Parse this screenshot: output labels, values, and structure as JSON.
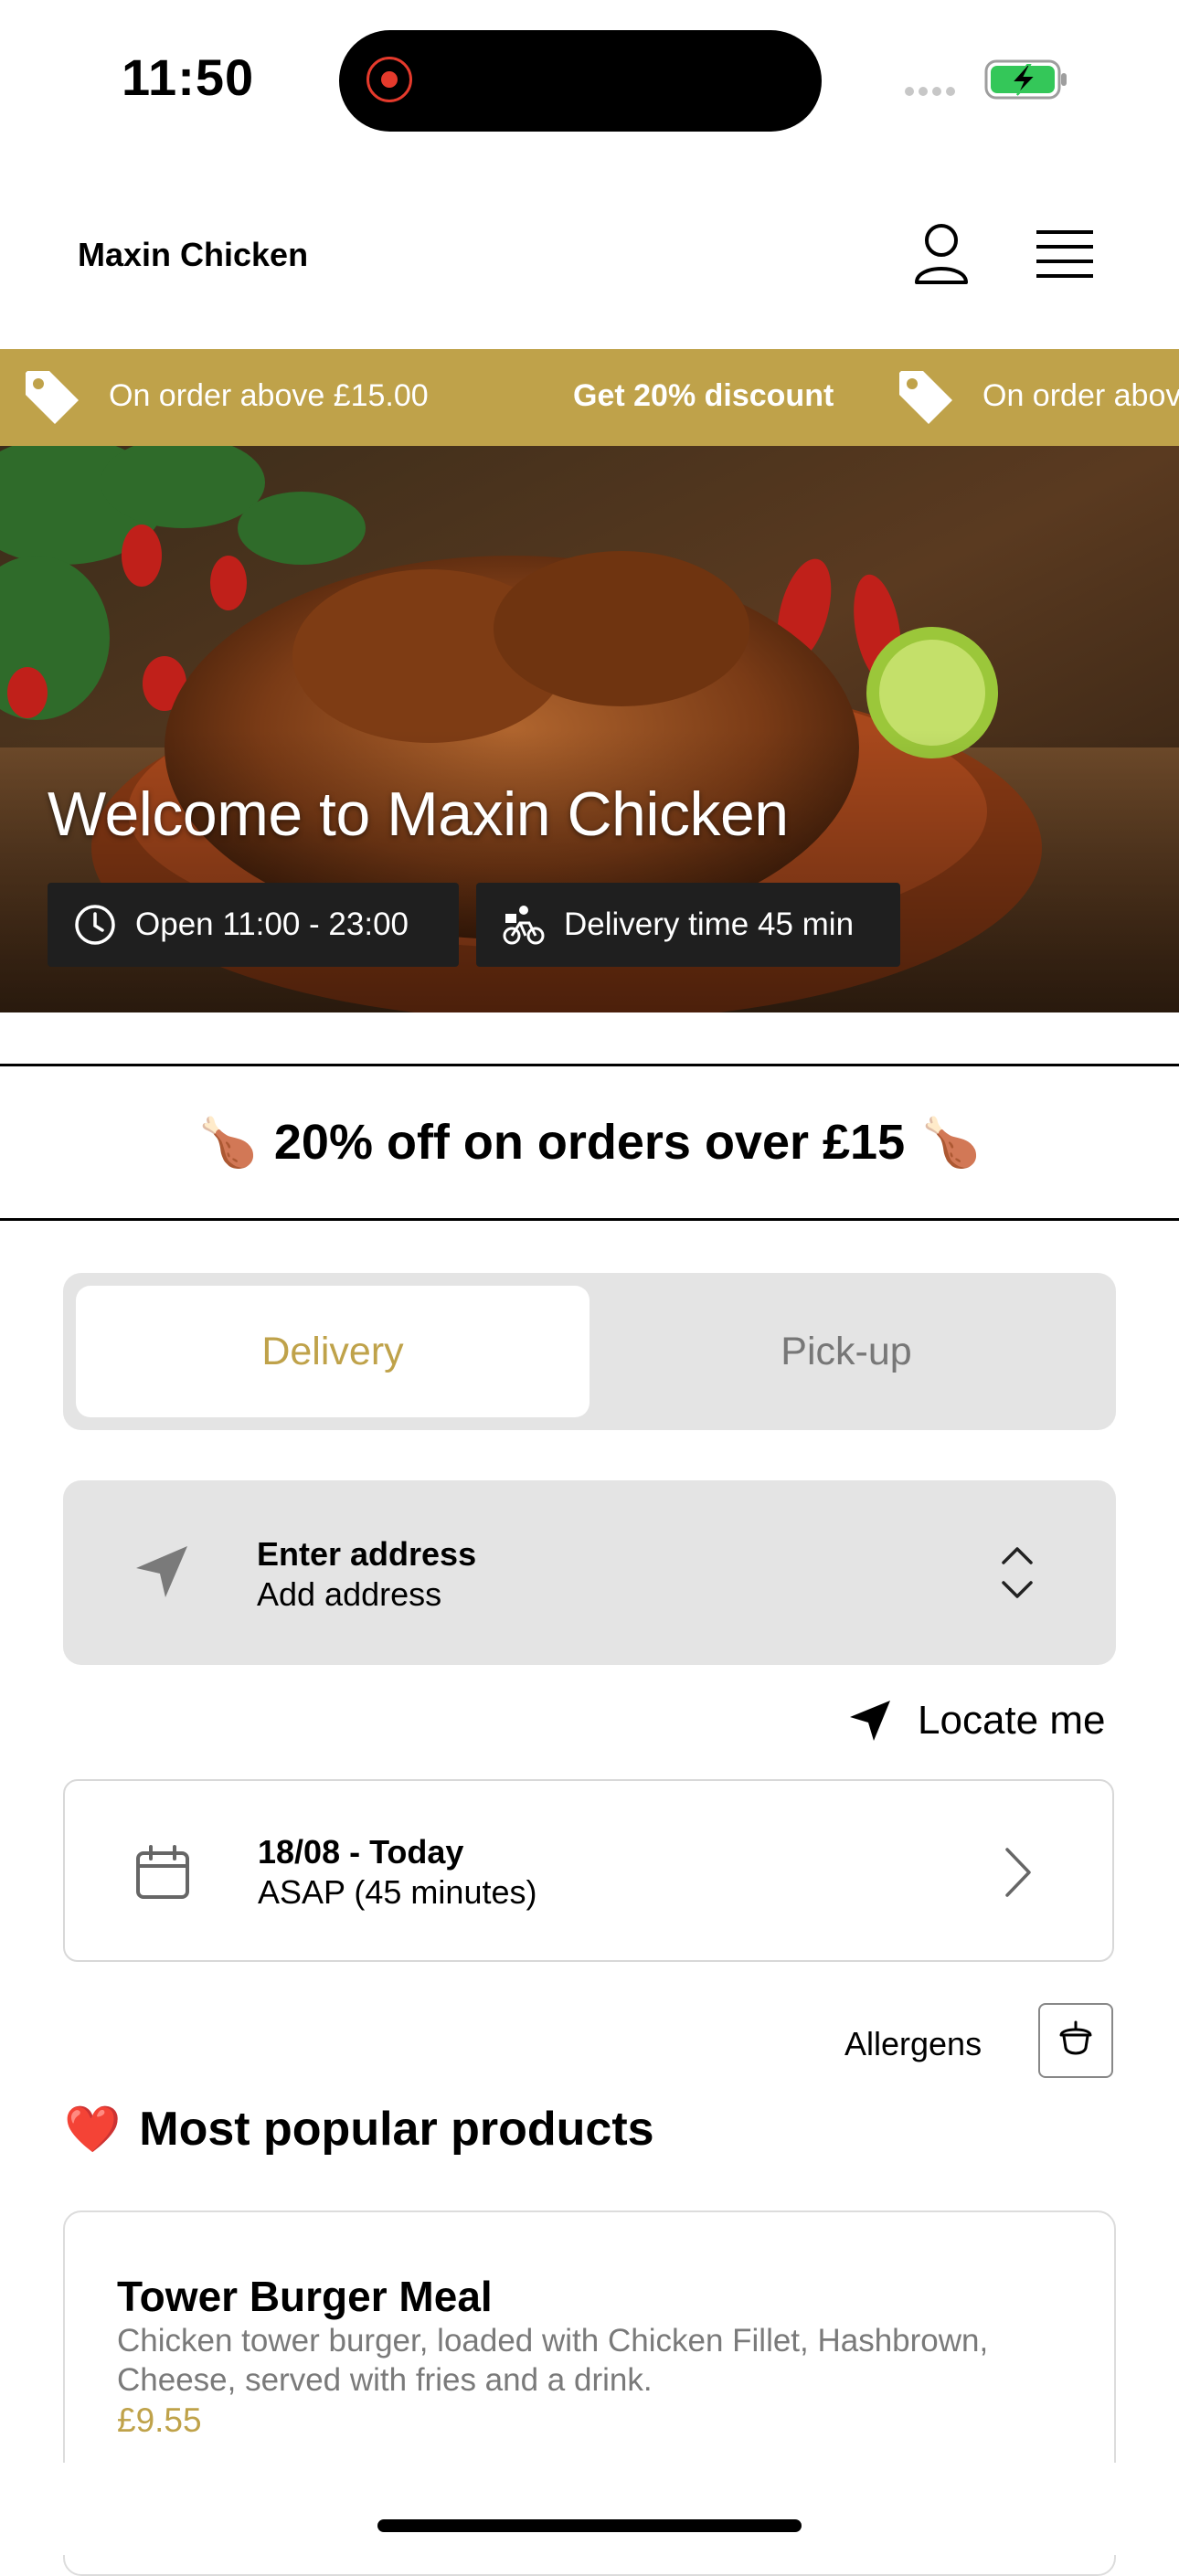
{
  "status_bar": {
    "time": "11:50"
  },
  "header": {
    "brand": "Maxin Chicken"
  },
  "promo_strip": {
    "items": [
      {
        "text": "On order above £15.00",
        "bold": false
      },
      {
        "text": "Get 20% discount",
        "bold": true
      },
      {
        "text": "On order above £15.00",
        "bold": false
      }
    ]
  },
  "hero": {
    "title": "Welcome to Maxin Chicken",
    "hours": "Open 11:00 - 23:00",
    "delivery_time": "Delivery time 45 min"
  },
  "offer_banner": {
    "emoji": "🍗",
    "text": "20% off on orders over £15"
  },
  "order_mode": {
    "tabs": [
      "Delivery",
      "Pick-up"
    ],
    "active": "Delivery"
  },
  "address": {
    "title": "Enter address",
    "subtitle": "Add address"
  },
  "locate": {
    "label": "Locate me"
  },
  "schedule": {
    "date": "18/08 - Today",
    "time": "ASAP (45 minutes)"
  },
  "allergens": {
    "label": "Allergens"
  },
  "popular": {
    "emoji": "❤️",
    "title": "Most popular products",
    "products": [
      {
        "name": "Tower Burger Meal",
        "description": "Chicken tower burger, loaded with Chicken Fillet, Hashbrown, Cheese, served with fries and a drink.",
        "price": "£9.55"
      }
    ]
  },
  "colors": {
    "accent": "#bfa24a",
    "panel": "#e4e4e4",
    "chip": "#1f1f1f"
  },
  "icons": [
    "record-icon",
    "signal-icon",
    "battery-icon",
    "user-icon",
    "menu-icon",
    "tag-icon",
    "clock-icon",
    "bike-icon",
    "navigation-icon",
    "chevron-updown-icon",
    "calendar-icon",
    "chevron-right-icon",
    "acorn-icon"
  ]
}
